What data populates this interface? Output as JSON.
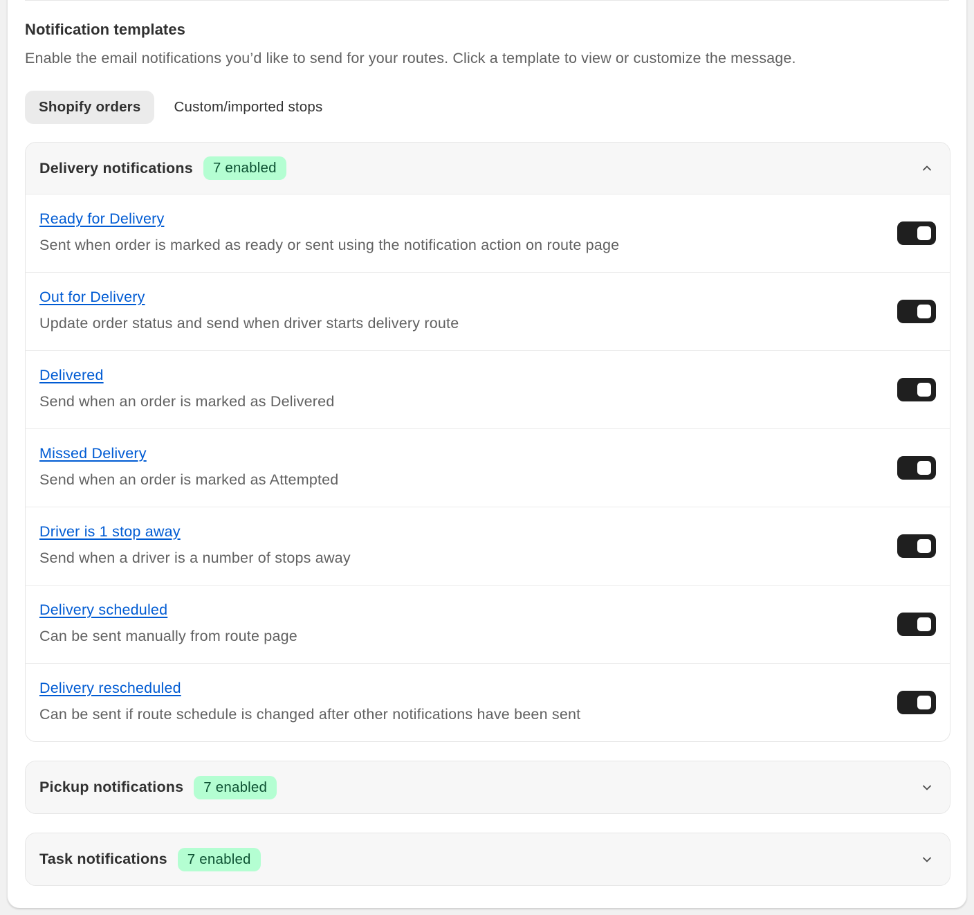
{
  "section": {
    "title": "Notification templates",
    "description": "Enable the email notifications you’d like to send for your routes. Click a template to view or customize the message."
  },
  "tabs": [
    {
      "label": "Shopify orders",
      "active": true
    },
    {
      "label": "Custom/imported stops",
      "active": false
    }
  ],
  "delivery": {
    "title": "Delivery notifications",
    "badge": "7 enabled",
    "expanded": true,
    "items": [
      {
        "title": "Ready for Delivery",
        "description": "Sent when order is marked as ready or sent using the notification action on route page",
        "enabled": true
      },
      {
        "title": "Out for Delivery",
        "description": "Update order status and send when driver starts delivery route",
        "enabled": true
      },
      {
        "title": "Delivered",
        "description": "Send when an order is marked as Delivered",
        "enabled": true
      },
      {
        "title": "Missed Delivery",
        "description": "Send when an order is marked as Attempted",
        "enabled": true
      },
      {
        "title": "Driver is 1 stop away",
        "description": "Send when a driver is a number of stops away",
        "enabled": true
      },
      {
        "title": "Delivery scheduled",
        "description": "Can be sent manually from route page",
        "enabled": true
      },
      {
        "title": "Delivery rescheduled",
        "description": "Can be sent if route schedule is changed after other notifications have been sent",
        "enabled": true
      }
    ]
  },
  "pickup": {
    "title": "Pickup notifications",
    "badge": "7 enabled",
    "expanded": false
  },
  "task": {
    "title": "Task notifications",
    "badge": "7 enabled",
    "expanded": false
  },
  "colors": {
    "link": "#005bd3",
    "badge_bg": "#b4fed2",
    "badge_text": "#0c5132",
    "toggle_on": "#1f1f1f"
  },
  "icons": {
    "collapse": "chevron-up-icon",
    "expand": "chevron-down-icon"
  }
}
